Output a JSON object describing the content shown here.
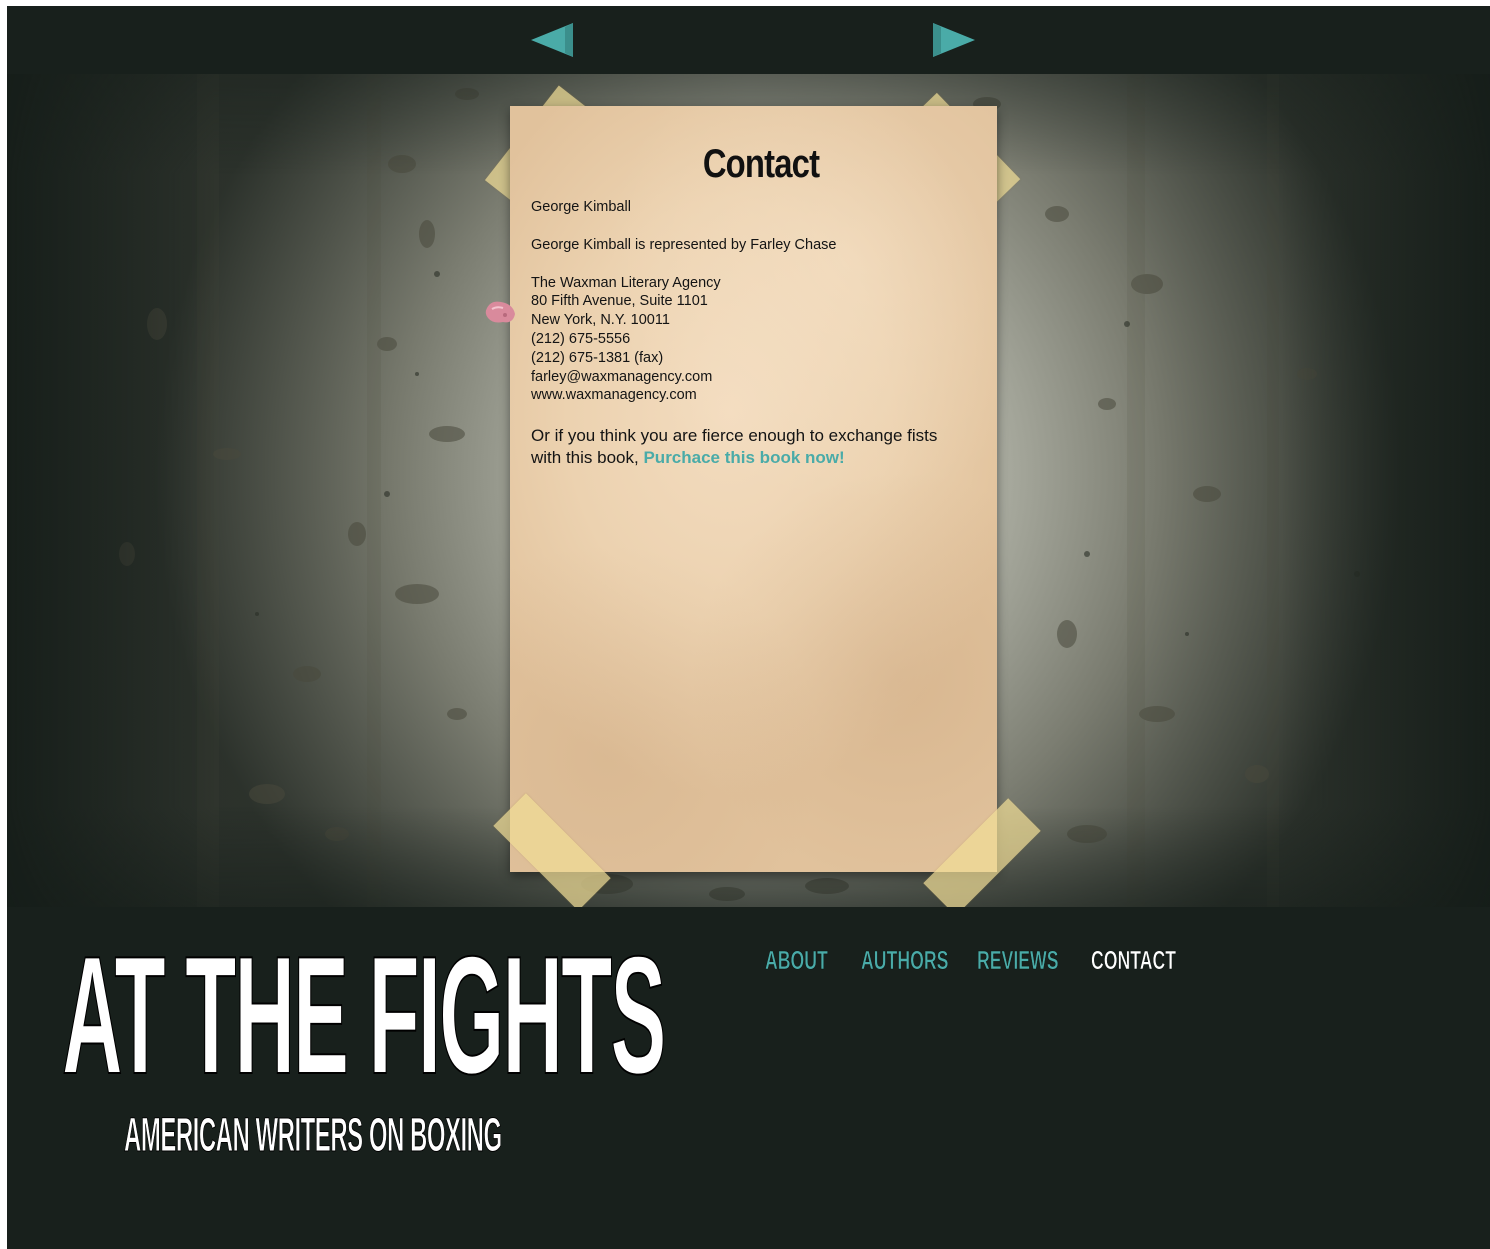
{
  "top_nav": {
    "prev_icon": "arrow-left-icon",
    "next_icon": "arrow-right-icon",
    "accent_color": "#4aaba8"
  },
  "paper": {
    "title": "Contact",
    "lines": {
      "name": "George Kimball",
      "represented": "George Kimball is represented by Farley Chase",
      "agency": "The Waxman Literary Agency",
      "address1": "80 Fifth Avenue, Suite 1101",
      "address2": "New York, N.Y. 10011",
      "phone": "(212) 675-5556",
      "fax": "(212) 675-1381 (fax)",
      "email": "farley@waxmanagency.com",
      "website": "www.waxmanagency.com"
    },
    "cta_text_1": "Or if you think you are fierce enough to exchange fists with this book,",
    "cta_link": "Purchace this book now!"
  },
  "brand": {
    "title": "AT THE FIGHTS",
    "subtitle": "AMERICAN WRITERS ON BOXING"
  },
  "main_nav": {
    "about": "ABOUT",
    "authors": "AUTHORS",
    "reviews": "REVIEWS",
    "contact": "CONTACT",
    "active": "CONTACT",
    "link_color": "#4aaba8",
    "active_color": "#ffffff"
  },
  "colors": {
    "background": "#18201c",
    "paper": "#ecd2b0"
  }
}
